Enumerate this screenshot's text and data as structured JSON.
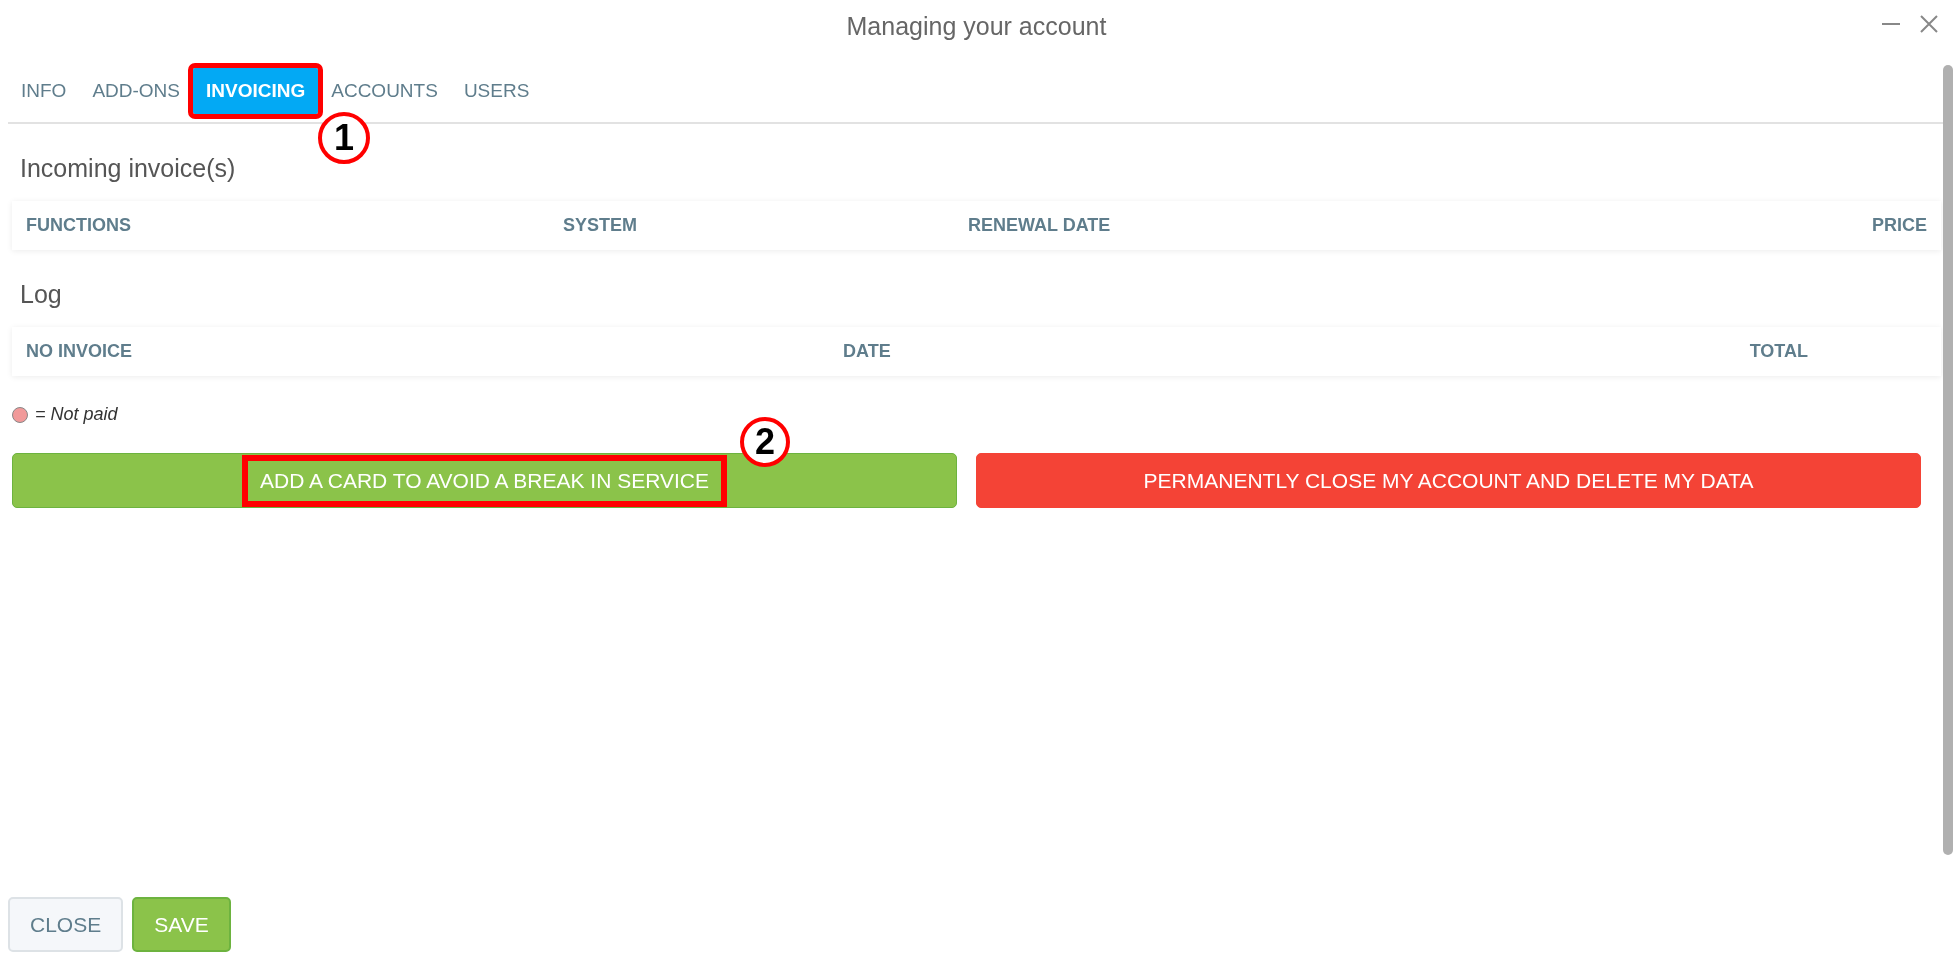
{
  "window": {
    "title": "Managing your account"
  },
  "tabs": [
    {
      "label": "INFO",
      "selected": false
    },
    {
      "label": "ADD-ONS",
      "selected": false
    },
    {
      "label": "INVOICING",
      "selected": true,
      "callout": "1"
    },
    {
      "label": "ACCOUNTS",
      "selected": false
    },
    {
      "label": "USERS",
      "selected": false
    }
  ],
  "incoming": {
    "title": "Incoming invoice(s)",
    "columns": [
      "FUNCTIONS",
      "SYSTEM",
      "RENEWAL DATE",
      "PRICE"
    ]
  },
  "log": {
    "title": "Log",
    "columns": [
      "NO INVOICE",
      "DATE",
      "TOTAL"
    ]
  },
  "legend": {
    "color": "#f19a9a",
    "label": "= Not paid"
  },
  "actions": [
    {
      "label": "ADD A CARD TO AVOID A BREAK IN SERVICE",
      "kind": "confirm",
      "callout": "2"
    },
    {
      "label": "PERMANENTLY CLOSE MY ACCOUNT AND DELETE MY DATA",
      "kind": "danger"
    }
  ],
  "footer_buttons": [
    {
      "label": "CLOSE",
      "kind": "secondary"
    },
    {
      "label": "SAVE",
      "kind": "confirm"
    }
  ]
}
